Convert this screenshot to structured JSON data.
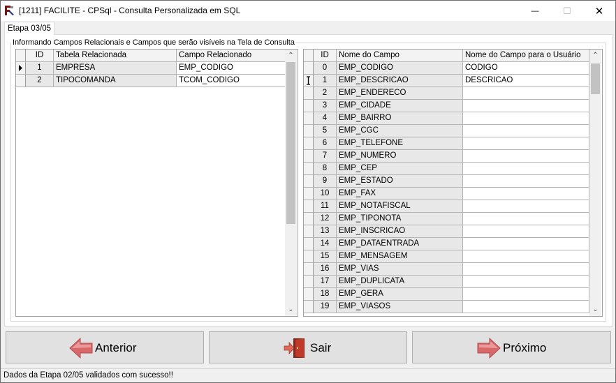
{
  "window": {
    "title": "[1211] FACILITE - CPSql - Consulta Personalizada em SQL",
    "app_icon": "facilite-app-icon",
    "controls": {
      "minimize": "—",
      "maximize": "☐",
      "close": "✕"
    }
  },
  "tab": {
    "label": "Etapa 03/05"
  },
  "group": {
    "title": "Informando Campos Relacionais e Campos que serão visíveis na Tela de Consulta"
  },
  "left_grid": {
    "columns": [
      "ID",
      "Tabela Relacionada",
      "Campo Relacionado"
    ],
    "rows": [
      {
        "id": "1",
        "tabela": "EMPRESA",
        "campo": "EMP_CODIGO"
      },
      {
        "id": "2",
        "tabela": "TIPOCOMANDA",
        "campo": "TCOM_CODIGO"
      }
    ]
  },
  "right_grid": {
    "columns": [
      "ID",
      "Nome do Campo",
      "Nome do Campo para o Usuário"
    ],
    "rows": [
      {
        "id": "0",
        "campo": "EMP_CODIGO",
        "usuario": "CODIGO"
      },
      {
        "id": "1",
        "campo": "EMP_DESCRICAO",
        "usuario": "DESCRICAO"
      },
      {
        "id": "2",
        "campo": "EMP_ENDERECO",
        "usuario": ""
      },
      {
        "id": "3",
        "campo": "EMP_CIDADE",
        "usuario": ""
      },
      {
        "id": "4",
        "campo": "EMP_BAIRRO",
        "usuario": ""
      },
      {
        "id": "5",
        "campo": "EMP_CGC",
        "usuario": ""
      },
      {
        "id": "6",
        "campo": "EMP_TELEFONE",
        "usuario": ""
      },
      {
        "id": "7",
        "campo": "EMP_NUMERO",
        "usuario": ""
      },
      {
        "id": "8",
        "campo": "EMP_CEP",
        "usuario": ""
      },
      {
        "id": "9",
        "campo": "EMP_ESTADO",
        "usuario": ""
      },
      {
        "id": "10",
        "campo": "EMP_FAX",
        "usuario": ""
      },
      {
        "id": "11",
        "campo": "EMP_NOTAFISCAL",
        "usuario": ""
      },
      {
        "id": "12",
        "campo": "EMP_TIPONOTA",
        "usuario": ""
      },
      {
        "id": "13",
        "campo": "EMP_INSCRICAO",
        "usuario": ""
      },
      {
        "id": "14",
        "campo": "EMP_DATAENTRADA",
        "usuario": ""
      },
      {
        "id": "15",
        "campo": "EMP_MENSAGEM",
        "usuario": ""
      },
      {
        "id": "16",
        "campo": "EMP_VIAS",
        "usuario": ""
      },
      {
        "id": "17",
        "campo": "EMP_DUPLICATA",
        "usuario": ""
      },
      {
        "id": "18",
        "campo": "EMP_GERA",
        "usuario": ""
      },
      {
        "id": "19",
        "campo": "EMP_VIASOS",
        "usuario": ""
      }
    ]
  },
  "buttons": {
    "anterior": {
      "label": "Anterior",
      "icon": "arrow-left-icon"
    },
    "sair": {
      "label": "Sair",
      "icon": "exit-door-icon"
    },
    "proximo": {
      "label": "Próximo",
      "icon": "arrow-right-icon"
    }
  },
  "status": {
    "text": "Dados da Etapa 02/05 validados com sucesso!!"
  },
  "colors": {
    "arrow": "#d9686a",
    "door": "#c0392b",
    "grid_fixed": "#e8e8e8"
  }
}
